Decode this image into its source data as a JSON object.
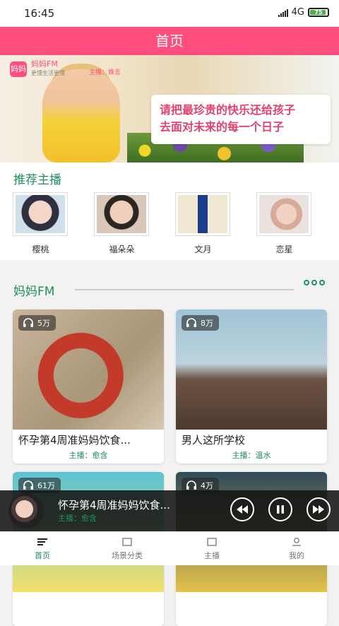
{
  "status_bar": {
    "time": "16:45",
    "network": "4G",
    "battery": "75"
  },
  "app_bar": {
    "title": "首页"
  },
  "banner": {
    "logo_badge": "妈妈",
    "logo_text": "妈妈FM",
    "logo_sub": "更懂生活更懂",
    "host": "主播：姝言",
    "lines": [
      "请把最珍贵的快乐还给孩子",
      "去面对未来的每一个日子"
    ]
  },
  "recommended": {
    "title": "推荐主播",
    "anchors": [
      {
        "name": "樱桃"
      },
      {
        "name": "福朵朵"
      },
      {
        "name": "文月"
      },
      {
        "name": "恋星"
      }
    ]
  },
  "fm": {
    "title": "妈妈FM",
    "items": [
      {
        "title": "怀孕第4周准妈妈饮食...",
        "host": "主播：愈含",
        "count": "5万"
      },
      {
        "title": "男人这所学校",
        "host": "主播：温水",
        "count": "8万"
      },
      {
        "title": "",
        "host": "",
        "count": "61万"
      },
      {
        "title": "",
        "host": "",
        "count": "4万"
      }
    ]
  },
  "player": {
    "title": "怀孕第4周准妈妈饮食...",
    "host": "主播：愈含"
  },
  "tabs": [
    {
      "label": "首页",
      "icon": "home-icon",
      "active": true
    },
    {
      "label": "场景分类",
      "icon": "category-icon",
      "active": false
    },
    {
      "label": "主播",
      "icon": "anchor-icon",
      "active": false
    },
    {
      "label": "我的",
      "icon": "profile-icon",
      "active": false
    }
  ],
  "colors": {
    "brand": "#ff4d7d",
    "accent_green": "#1e8f5a"
  }
}
